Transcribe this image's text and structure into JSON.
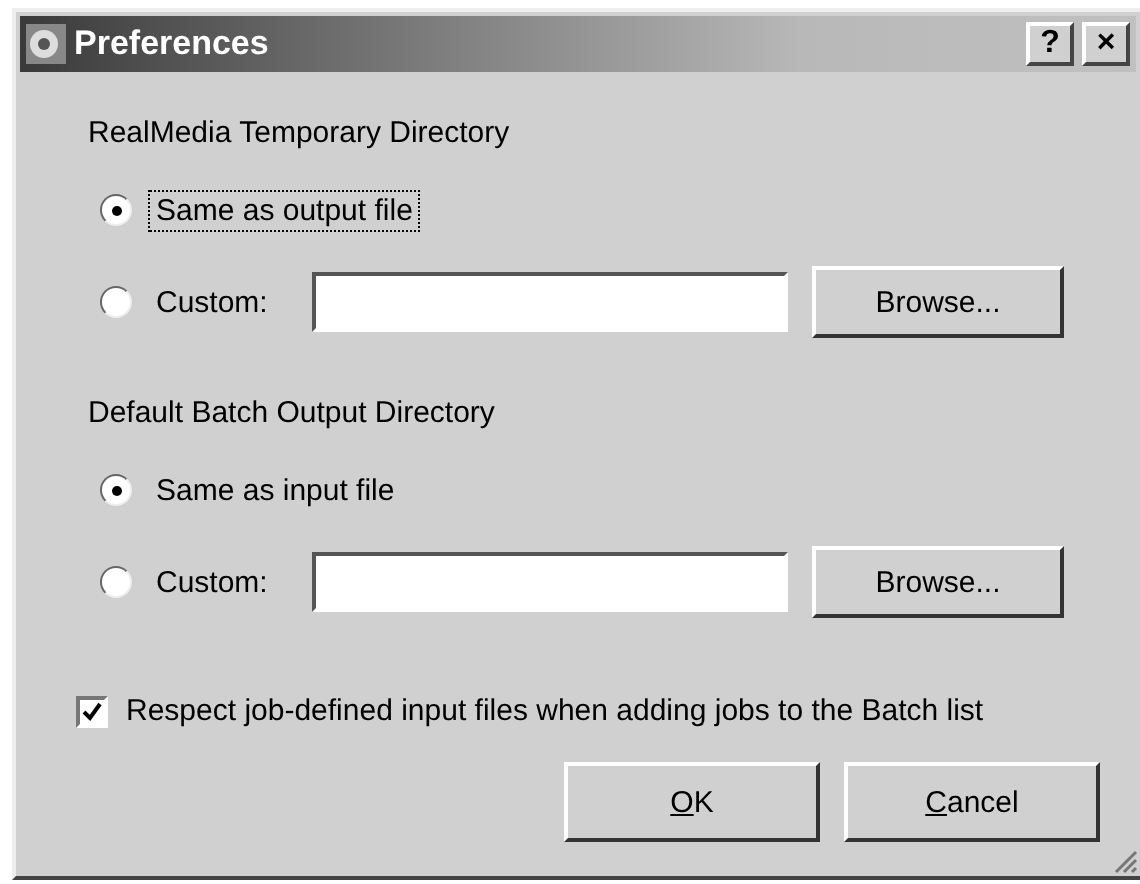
{
  "window": {
    "title": "Preferences",
    "buttons": [
      {
        "label": "?"
      },
      {
        "label": "×"
      }
    ]
  },
  "groups": [
    {
      "heading": "RealMedia Temporary Directory",
      "options": [
        {
          "label": "Same as output file",
          "selected": true,
          "focused": true,
          "kind": "plain"
        },
        {
          "label": "Custom:",
          "selected": false,
          "focused": false,
          "kind": "path",
          "button": "Browse..."
        }
      ]
    },
    {
      "heading": "Default Batch Output Directory",
      "options": [
        {
          "label": "Same as input file",
          "selected": true,
          "focused": false,
          "kind": "plain"
        },
        {
          "label": "Custom:",
          "selected": false,
          "focused": false,
          "kind": "path",
          "button": "Browse..."
        }
      ]
    }
  ],
  "respect_checkbox": {
    "label": "Respect job-defined input files when adding jobs to the Batch list",
    "checked": true
  },
  "buttons": [
    {
      "mnemonic": "O",
      "rest": "K"
    },
    {
      "mnemonic": "C",
      "rest": "ancel"
    }
  ]
}
